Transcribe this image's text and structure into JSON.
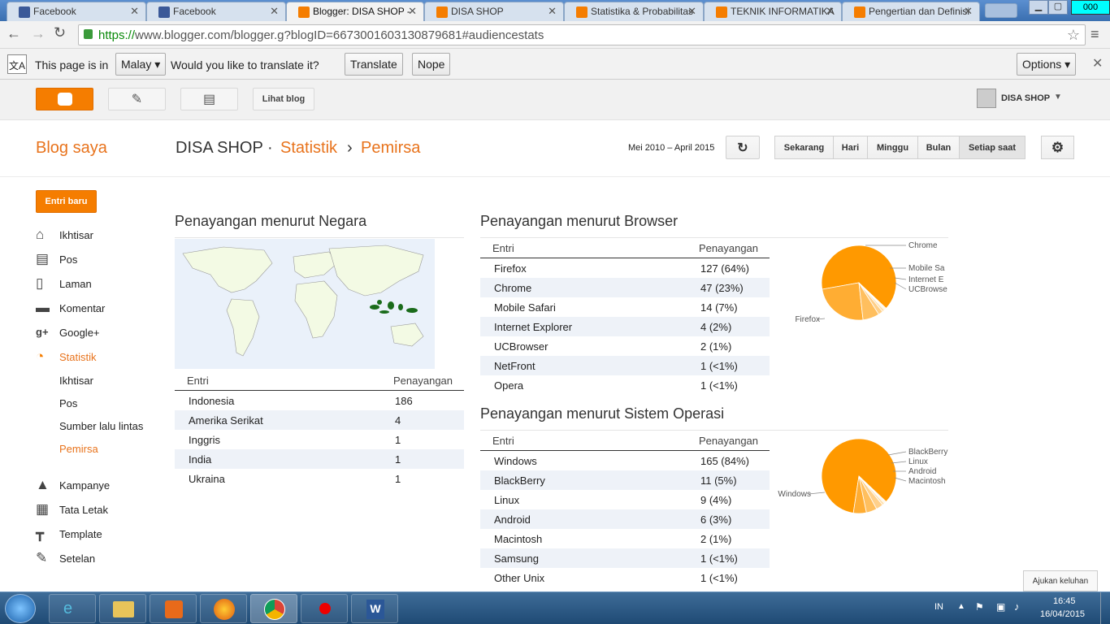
{
  "browser": {
    "tabs": [
      {
        "label": "Facebook",
        "color": "#3b5998",
        "active": false
      },
      {
        "label": "Facebook",
        "color": "#3b5998",
        "active": false
      },
      {
        "label": "Blogger: DISA SHOP - ",
        "color": "#f57d00",
        "active": true
      },
      {
        "label": "DISA SHOP",
        "color": "#f57d00",
        "active": false
      },
      {
        "label": "Statistika & Probabilitas",
        "color": "#f57d00",
        "active": false
      },
      {
        "label": "TEKNIK INFORMATIKA",
        "color": "#f57d00",
        "active": false
      },
      {
        "label": "Pengertian dan Definisi",
        "color": "#f57d00",
        "active": false
      }
    ],
    "url_scheme": "https://",
    "url_rest": "www.blogger.com/blogger.g?blogID=6673001603130879681#audiencestats",
    "corner_badge": "000"
  },
  "translate_bar": {
    "prefix": "This page is in",
    "language": "Malay",
    "question": "Would you like to translate it?",
    "translate_label": "Translate",
    "nope_label": "Nope",
    "options_label": "Options"
  },
  "blogger_header": {
    "view_blog_label": "Lihat blog",
    "account_name": "DISA SHOP"
  },
  "title_row": {
    "my_blogs": "Blog saya",
    "blog_name": "DISA SHOP",
    "sep1": "·",
    "section": "Statistik",
    "sep2": "›",
    "subsection": "Pemirsa",
    "date_range": "Mei 2010 – April 2015",
    "ranges": [
      "Sekarang",
      "Hari",
      "Minggu",
      "Bulan",
      "Setiap saat"
    ]
  },
  "sidebar": {
    "new_post_label": "Entri baru",
    "items": [
      {
        "label": "Ikhtisar",
        "icon": "home-icon",
        "glyph": "⌂"
      },
      {
        "label": "Pos",
        "icon": "posts-icon",
        "glyph": "▤"
      },
      {
        "label": "Laman",
        "icon": "page-icon",
        "glyph": "▯"
      },
      {
        "label": "Komentar",
        "icon": "comment-icon",
        "glyph": "▬"
      },
      {
        "label": "Google+",
        "icon": "google-plus-icon",
        "glyph": "g+"
      },
      {
        "label": "Statistik",
        "icon": "stats-icon",
        "glyph": "◔"
      }
    ],
    "stats_sub": [
      "Ikhtisar",
      "Pos",
      "Sumber lalu lintas",
      "Pemirsa"
    ],
    "items2": [
      {
        "label": "Kampanye",
        "icon": "campaign-icon",
        "glyph": "▲"
      },
      {
        "label": "Tata Letak",
        "icon": "layout-icon",
        "glyph": "▦"
      },
      {
        "label": "Template",
        "icon": "template-icon",
        "glyph": "┳"
      },
      {
        "label": "Setelan",
        "icon": "wrench-icon",
        "glyph": "✎"
      }
    ]
  },
  "country": {
    "title": "Penayangan menurut Negara",
    "col1": "Entri",
    "col2": "Penayangan",
    "rows": [
      {
        "name": "Indonesia",
        "views": "186"
      },
      {
        "name": "Amerika Serikat",
        "views": "4"
      },
      {
        "name": "Inggris",
        "views": "1"
      },
      {
        "name": "India",
        "views": "1"
      },
      {
        "name": "Ukraina",
        "views": "1"
      }
    ]
  },
  "browser_stats": {
    "title": "Penayangan menurut Browser",
    "col1": "Entri",
    "col2": "Penayangan",
    "rows": [
      {
        "name": "Firefox",
        "views": "127 (64%)"
      },
      {
        "name": "Chrome",
        "views": "47 (23%)"
      },
      {
        "name": "Mobile Safari",
        "views": "14 (7%)"
      },
      {
        "name": "Internet Explorer",
        "views": "4 (2%)"
      },
      {
        "name": "UCBrowser",
        "views": "2 (1%)"
      },
      {
        "name": "NetFront",
        "views": "1 (<1%)"
      },
      {
        "name": "Opera",
        "views": "1 (<1%)"
      }
    ],
    "pie_labels": [
      "Chrome",
      "Mobile Sa",
      "Internet E",
      "UCBrowse",
      "Firefox"
    ],
    "pie_values": [
      127,
      47,
      14,
      4,
      2,
      1,
      1
    ]
  },
  "os_stats": {
    "title": "Penayangan menurut Sistem Operasi",
    "col1": "Entri",
    "col2": "Penayangan",
    "rows": [
      {
        "name": "Windows",
        "views": "165 (84%)"
      },
      {
        "name": "BlackBerry",
        "views": "11 (5%)"
      },
      {
        "name": "Linux",
        "views": "9 (4%)"
      },
      {
        "name": "Android",
        "views": "6 (3%)"
      },
      {
        "name": "Macintosh",
        "views": "2 (1%)"
      },
      {
        "name": "Samsung",
        "views": "1 (<1%)"
      },
      {
        "name": "Other Unix",
        "views": "1 (<1%)"
      }
    ],
    "pie_labels": [
      "BlackBerry",
      "Linux",
      "Android",
      "Macintosh",
      "Windows"
    ],
    "pie_values": [
      165,
      11,
      9,
      6,
      2,
      1,
      1
    ]
  },
  "feedback_label": "Ajukan keluhan",
  "taskbar": {
    "lang": "IN",
    "time": "16:45",
    "date": "16/04/2015"
  },
  "colors": {
    "orange": "#e8731c",
    "pie_orange": "#ff9900",
    "map_highlight": "#1a6b1a"
  }
}
